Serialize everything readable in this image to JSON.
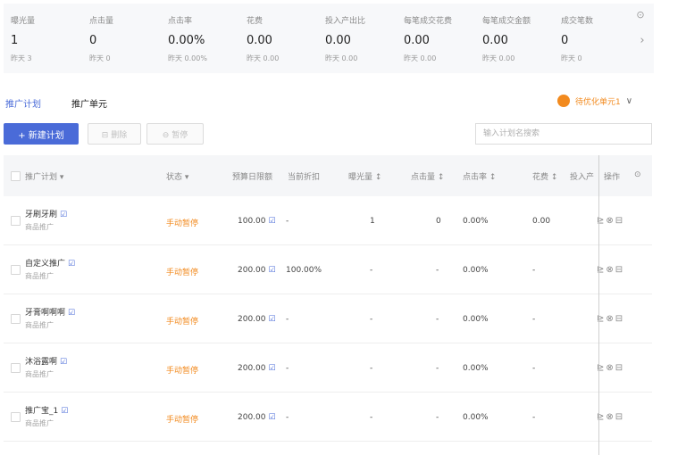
{
  "stats": [
    {
      "label": "曝光量",
      "value": "1",
      "sub": "昨天 3"
    },
    {
      "label": "点击量",
      "value": "0",
      "sub": "昨天 0"
    },
    {
      "label": "点击率",
      "value": "0.00%",
      "sub": "昨天 0.00%"
    },
    {
      "label": "花费",
      "value": "0.00",
      "sub": "昨天 0.00"
    },
    {
      "label": "投入产出比",
      "value": "0.00",
      "sub": "昨天 0.00"
    },
    {
      "label": "每笔成交花费",
      "value": "0.00",
      "sub": "昨天 0.00"
    },
    {
      "label": "每笔成交金额",
      "value": "0.00",
      "sub": "昨天 0.00"
    },
    {
      "label": "成交笔数",
      "value": "0",
      "sub": "昨天 0"
    }
  ],
  "stats_icons": {
    "settings": "settings-icon",
    "next": "chevron-right-icon"
  },
  "tabs": {
    "plans": "推广计划",
    "units": "推广单元"
  },
  "optimize": {
    "label": "待优化单元1",
    "color": "#f28a1e"
  },
  "toolbar": {
    "new_plan": "+ 新建计划",
    "delete": "⊟ 删除",
    "pause": "⊖ 暂停",
    "search_placeholder": "输入计划名搜索"
  },
  "table": {
    "headers": {
      "plan": "推广计划 ▾",
      "status": "状态 ▾",
      "budget": "预算日限额",
      "discount": "当前折扣",
      "impressions": "曝光量 ↕",
      "clicks": "点击量 ↕",
      "ctr": "点击率 ↕",
      "spend": "花费 ↕",
      "roi": "投入产",
      "actions": "操作"
    },
    "rows": [
      {
        "name": "牙刷牙刷",
        "type": "商品推广",
        "status": "手动暂停",
        "budget": "100.00",
        "discount": "-",
        "impressions": "1",
        "clicks": "0",
        "ctr": "0.00%",
        "spend": "0.00"
      },
      {
        "name": "自定义推广",
        "type": "商品推广",
        "status": "手动暂停",
        "budget": "200.00",
        "discount": "100.00%",
        "impressions": "-",
        "clicks": "-",
        "ctr": "0.00%",
        "spend": "-"
      },
      {
        "name": "牙膏啊啊啊",
        "type": "商品推广",
        "status": "手动暂停",
        "budget": "200.00",
        "discount": "-",
        "impressions": "-",
        "clicks": "-",
        "ctr": "0.00%",
        "spend": "-"
      },
      {
        "name": "沐浴露啊",
        "type": "商品推广",
        "status": "手动暂停",
        "budget": "200.00",
        "discount": "-",
        "impressions": "-",
        "clicks": "-",
        "ctr": "0.00%",
        "spend": "-"
      },
      {
        "name": "推广宝_1",
        "type": "商品推广",
        "status": "手动暂停",
        "budget": "200.00",
        "discount": "-",
        "impressions": "-",
        "clicks": "-",
        "ctr": "0.00%",
        "spend": "-"
      }
    ]
  },
  "colors": {
    "accent": "#4a6bd8",
    "status": "#f28a1e"
  }
}
